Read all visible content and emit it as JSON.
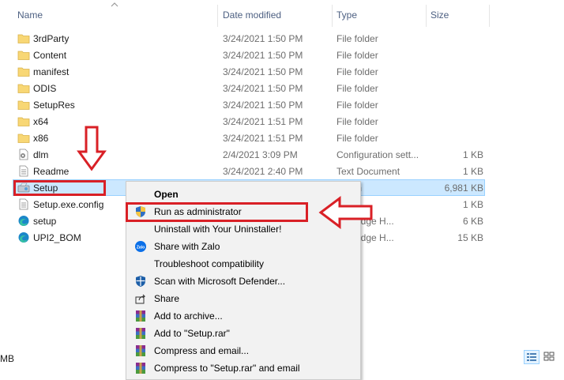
{
  "columns": {
    "name": "Name",
    "date_modified": "Date modified",
    "type": "Type",
    "size": "Size"
  },
  "files": [
    {
      "name": "3rdParty",
      "date": "3/24/2021 1:50 PM",
      "type": "File folder",
      "size": "",
      "icon": "folder-icon"
    },
    {
      "name": "Content",
      "date": "3/24/2021 1:50 PM",
      "type": "File folder",
      "size": "",
      "icon": "folder-icon"
    },
    {
      "name": "manifest",
      "date": "3/24/2021 1:50 PM",
      "type": "File folder",
      "size": "",
      "icon": "folder-icon"
    },
    {
      "name": "ODIS",
      "date": "3/24/2021 1:50 PM",
      "type": "File folder",
      "size": "",
      "icon": "folder-icon"
    },
    {
      "name": "SetupRes",
      "date": "3/24/2021 1:50 PM",
      "type": "File folder",
      "size": "",
      "icon": "folder-icon"
    },
    {
      "name": "x64",
      "date": "3/24/2021 1:51 PM",
      "type": "File folder",
      "size": "",
      "icon": "folder-icon"
    },
    {
      "name": "x86",
      "date": "3/24/2021 1:51 PM",
      "type": "File folder",
      "size": "",
      "icon": "folder-icon"
    },
    {
      "name": "dlm",
      "date": "2/4/2021 3:09 PM",
      "type": "Configuration sett...",
      "size": "1 KB",
      "icon": "config-file-icon"
    },
    {
      "name": "Readme",
      "date": "3/24/2021 2:40 PM",
      "type": "Text Document",
      "size": "1 KB",
      "icon": "text-file-icon"
    },
    {
      "name": "Setup",
      "date": "",
      "type": "cation",
      "size": "6,981 KB",
      "icon": "setup-exe-icon",
      "selected": true
    },
    {
      "name": "Setup.exe.config",
      "date": "",
      "type": "File",
      "size": "1 KB",
      "icon": "text-file-icon"
    },
    {
      "name": "setup",
      "date": "",
      "type": "soft Edge H...",
      "size": "6 KB",
      "icon": "edge-icon"
    },
    {
      "name": "UPI2_BOM",
      "date": "",
      "type": "soft Edge H...",
      "size": "15 KB",
      "icon": "edge-icon"
    }
  ],
  "context_menu": [
    {
      "label": "Open",
      "bold": true,
      "icon": ""
    },
    {
      "label": "Run as administrator",
      "bold": false,
      "icon": "uac-shield-icon"
    },
    {
      "label": "Uninstall with Your Uninstaller!",
      "bold": false,
      "icon": ""
    },
    {
      "label": "Share with Zalo",
      "bold": false,
      "icon": "zalo-icon"
    },
    {
      "label": "Troubleshoot compatibility",
      "bold": false,
      "icon": ""
    },
    {
      "label": "Scan with Microsoft Defender...",
      "bold": false,
      "icon": "defender-icon"
    },
    {
      "label": "Share",
      "bold": false,
      "icon": "share-icon"
    },
    {
      "label": "Add to archive...",
      "bold": false,
      "icon": "winrar-icon"
    },
    {
      "label": "Add to \"Setup.rar\"",
      "bold": false,
      "icon": "winrar-icon"
    },
    {
      "label": "Compress and email...",
      "bold": false,
      "icon": "winrar-icon"
    },
    {
      "label": "Compress to \"Setup.rar\" and email",
      "bold": false,
      "icon": "winrar-icon"
    }
  ],
  "status_bar": {
    "text": "MB"
  },
  "colors": {
    "annotation_red": "#d92026",
    "selection": "#cce8ff",
    "folder": "#f8d775"
  }
}
